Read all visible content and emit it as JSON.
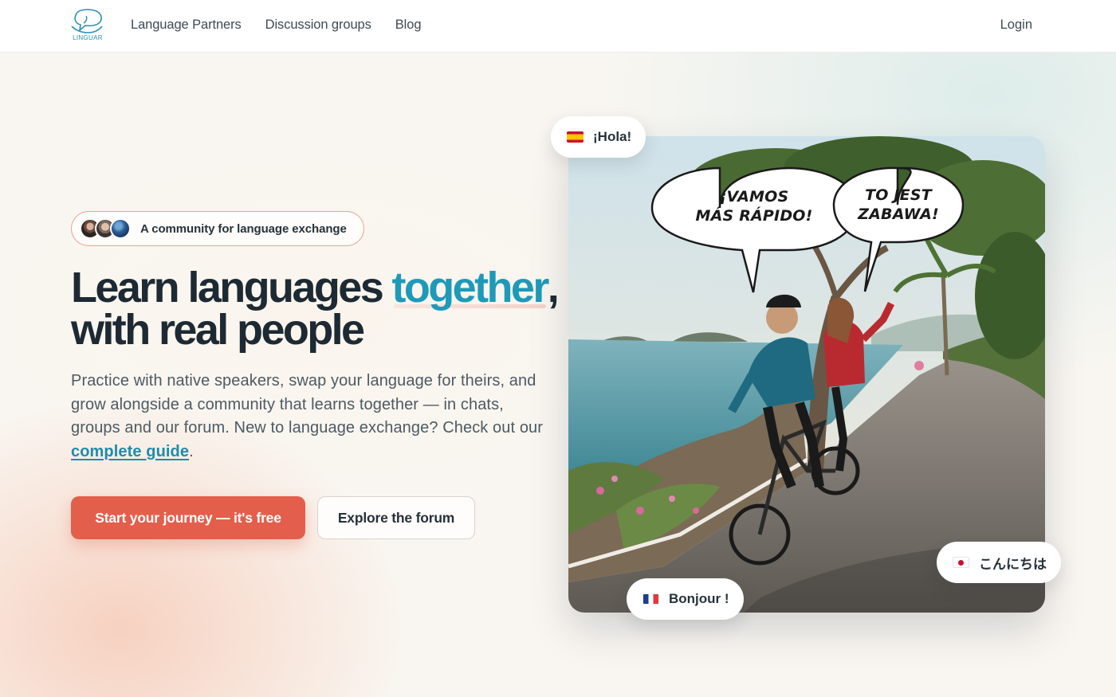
{
  "brand": {
    "name": "LINGUAR",
    "accent": "#1e9ab8",
    "cta_color": "#e35f4b"
  },
  "nav": {
    "items": [
      {
        "label": "Language Partners"
      },
      {
        "label": "Discussion groups"
      },
      {
        "label": "Blog"
      }
    ],
    "login_label": "Login"
  },
  "hero": {
    "badge_text": "A community for language exchange",
    "headline_part1": "Learn languages ",
    "headline_accent": "together",
    "headline_part2": ",",
    "headline_line2": "with real people",
    "description": "Practice with native speakers, swap your language for theirs, and grow alongside a community that learns together — in chats, groups and our forum. New to language exchange? Check out our ",
    "guide_link_text": "complete guide",
    "description_end": ".",
    "primary_button": "Start your journey — it's free",
    "secondary_button": "Explore the forum"
  },
  "image": {
    "speech_left_line1": "¡VAMOS",
    "speech_left_line2": "MÁS RÁPIDO!",
    "speech_right_line1": "TO JEST",
    "speech_right_line2": "ZABAWA!"
  },
  "chips": {
    "spanish": {
      "label": "¡Hola!",
      "flag": "flag-es-icon"
    },
    "french": {
      "label": "Bonjour !",
      "flag": "flag-fr-icon"
    },
    "japanese": {
      "label": "こんにちは",
      "flag": "flag-jp-icon"
    }
  }
}
